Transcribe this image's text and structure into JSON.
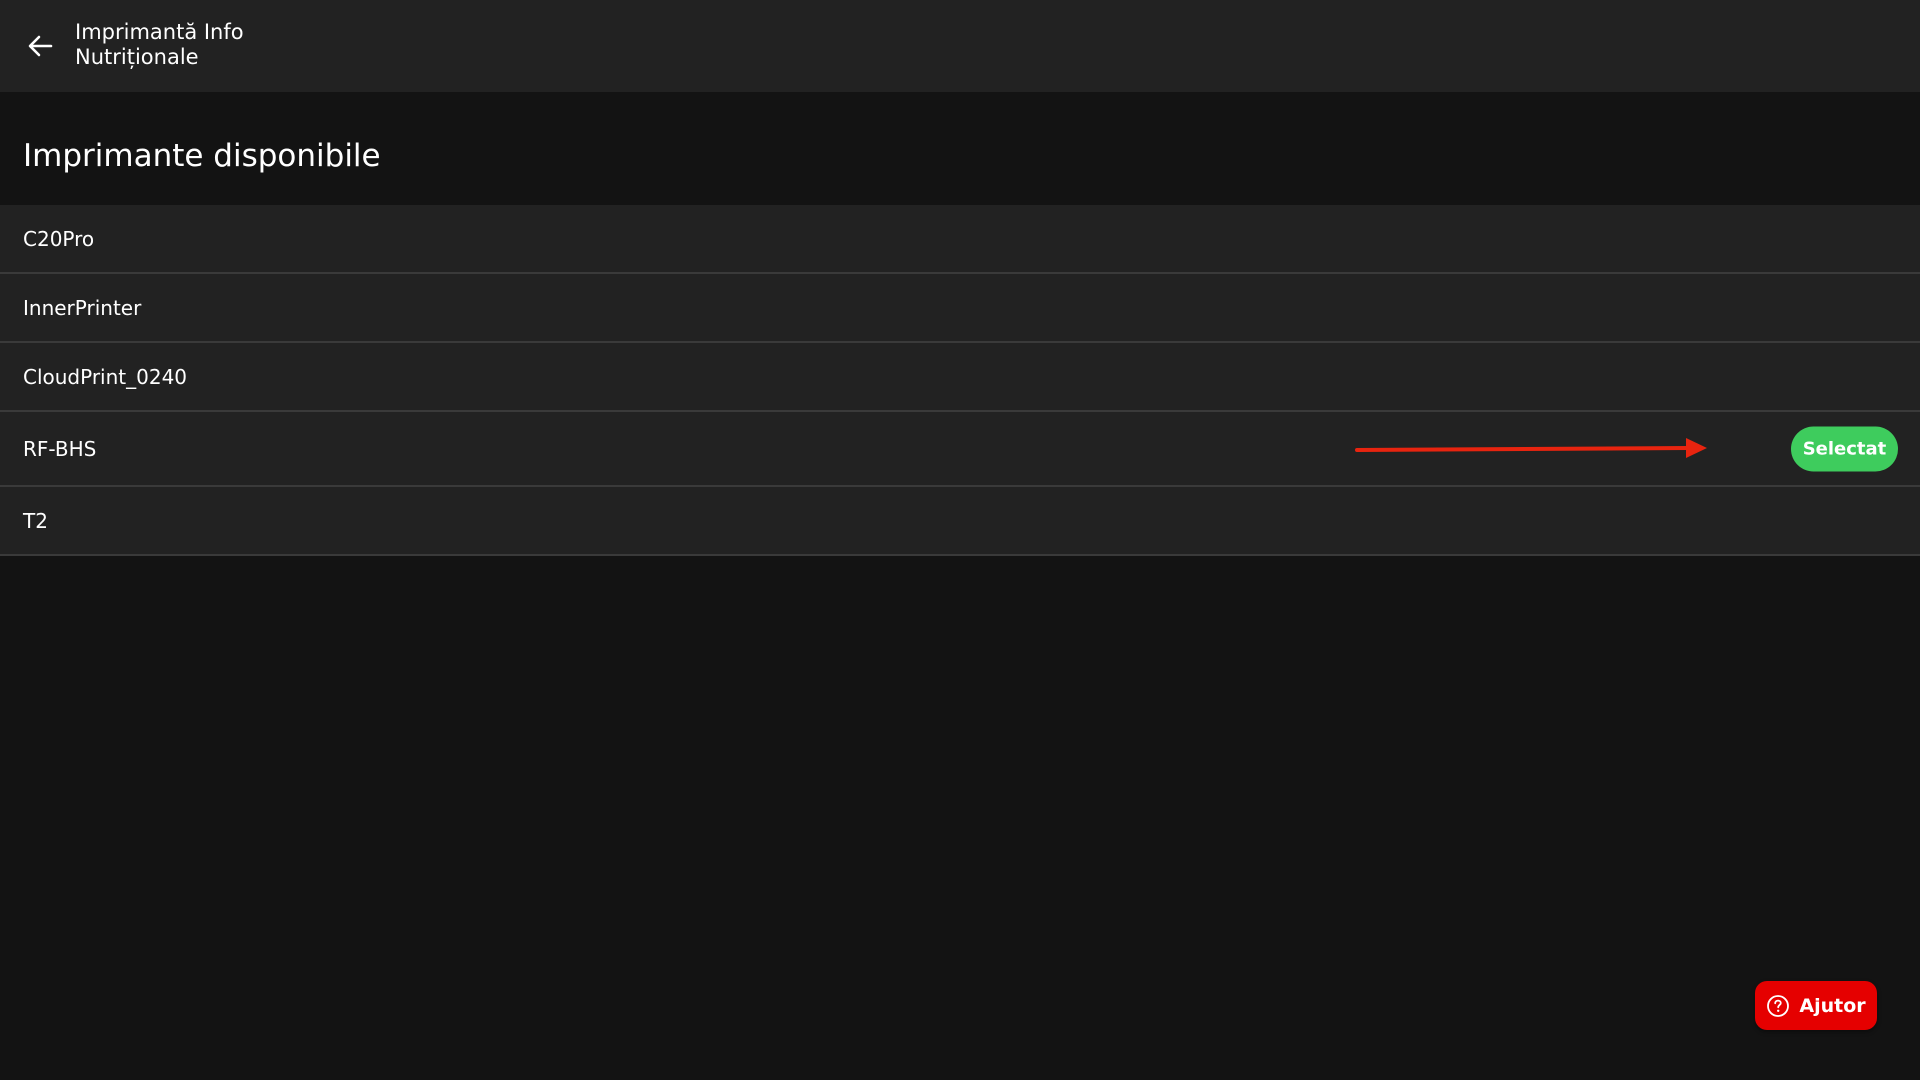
{
  "appbar": {
    "title": "Imprimantă Info Nutriționale",
    "back_icon": "arrow-left-icon"
  },
  "section": {
    "title": "Imprimante disponibile"
  },
  "printers": [
    {
      "name": "C20Pro",
      "selected": false
    },
    {
      "name": "InnerPrinter",
      "selected": false
    },
    {
      "name": "CloudPrint_0240",
      "selected": false
    },
    {
      "name": "RF-BHS",
      "selected": true,
      "badge_label": "Selectat"
    },
    {
      "name": "T2",
      "selected": false
    }
  ],
  "help": {
    "label": "Ajutor",
    "icon": "help-circle-icon"
  },
  "colors": {
    "appbar_bg": "#222222",
    "page_bg": "#131313",
    "row_bg": "#222222",
    "selected_green": "#3ecc5d",
    "help_red": "#e50000",
    "annotation_arrow": "#e8240f"
  }
}
